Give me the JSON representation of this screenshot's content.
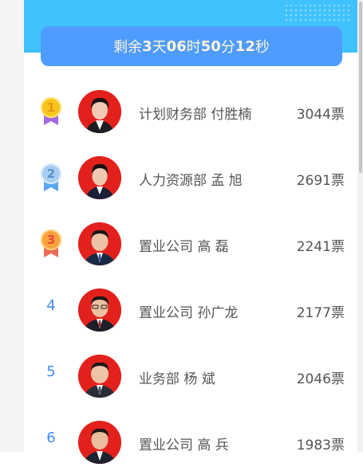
{
  "countdown": {
    "prefix": "剩余",
    "days": "3",
    "days_unit": "天",
    "hours": "06",
    "hours_unit": "时",
    "minutes": "50",
    "minutes_unit": "分",
    "seconds": "12",
    "seconds_unit": "秒"
  },
  "colors": {
    "header": "#40c2ff",
    "countdown_bg": "#4e9cff",
    "rank_text": "#3e8ef7",
    "gold": "#f9c41b",
    "silver": "#a9cdf2",
    "bronze": "#f7a23b"
  },
  "rankings": [
    {
      "rank": "1",
      "medal": "gold-medal-icon",
      "name": "计划财务部 付胜楠",
      "votes": "3044票"
    },
    {
      "rank": "2",
      "medal": "silver-medal-icon",
      "name": "人力资源部 孟 旭",
      "votes": "2691票"
    },
    {
      "rank": "3",
      "medal": "bronze-medal-icon",
      "name": "置业公司 高 磊",
      "votes": "2241票"
    },
    {
      "rank": "4",
      "name": "置业公司 孙广龙",
      "votes": "2177票"
    },
    {
      "rank": "5",
      "name": "业务部 杨 斌",
      "votes": "2046票"
    },
    {
      "rank": "6",
      "name": "置业公司 高 兵",
      "votes": "1983票"
    }
  ]
}
